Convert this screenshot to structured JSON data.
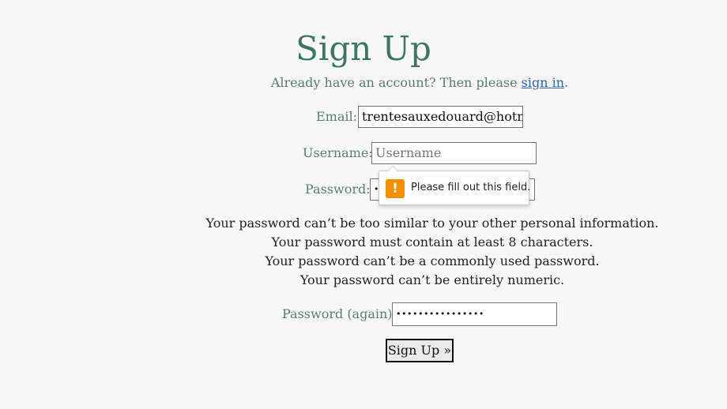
{
  "form": {
    "title": "Sign Up",
    "subtitle": {
      "prefix": "Already have an account? Then please ",
      "link_text": "sign in",
      "suffix": "."
    },
    "fields": {
      "email": {
        "label": "Email:",
        "value": "trentesauxedouard@hotm"
      },
      "username": {
        "label": "Username:",
        "placeholder": "Username",
        "value": ""
      },
      "password": {
        "label": "Password:",
        "value": "•"
      },
      "password_again": {
        "label": "Password (again):",
        "value": "••••••••••••••••"
      }
    },
    "password_help": [
      "Your password can’t be too similar to your other personal information.",
      "Your password must contain at least 8 characters.",
      "Your password can’t be a commonly used password.",
      "Your password can’t be entirely numeric."
    ],
    "submit_label": "Sign Up »"
  },
  "validation_tooltip": {
    "icon": "warning-icon",
    "icon_glyph": "!",
    "message": "Please fill out this field.",
    "icon_color": "#f29000"
  },
  "colors": {
    "background": "#f8f8f8",
    "title": "#3f7564",
    "label": "#5a7f72",
    "link": "#2d63b2",
    "text": "#222222"
  }
}
